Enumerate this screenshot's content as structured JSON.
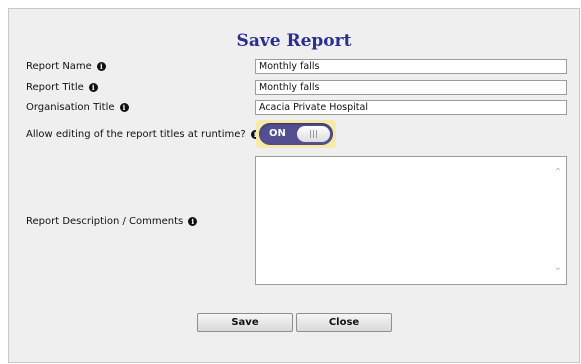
{
  "dialog": {
    "title": "Save Report",
    "fields": {
      "report_name": {
        "label": "Report Name",
        "value": "Monthly falls"
      },
      "report_title": {
        "label": "Report Title",
        "value": "Monthly falls"
      },
      "organisation_title": {
        "label": "Organisation Title",
        "value": "Acacia Private Hospital"
      }
    },
    "runtime_edit": {
      "label": "Allow editing of the report titles at runtime?",
      "state": "ON"
    },
    "description": {
      "label": "Report Description / Comments",
      "value": ""
    },
    "buttons": {
      "save": "Save",
      "close": "Close"
    },
    "info_glyph": "i"
  },
  "colors": {
    "title": "#2b2e8e",
    "toggle_on": "#544f91",
    "toggle_focus": "#f7e9a8",
    "dialog_bg": "#efefef"
  },
  "icons": {
    "info": "info-icon",
    "scroll_up": "chevron-up-icon",
    "scroll_down": "chevron-down-icon"
  }
}
